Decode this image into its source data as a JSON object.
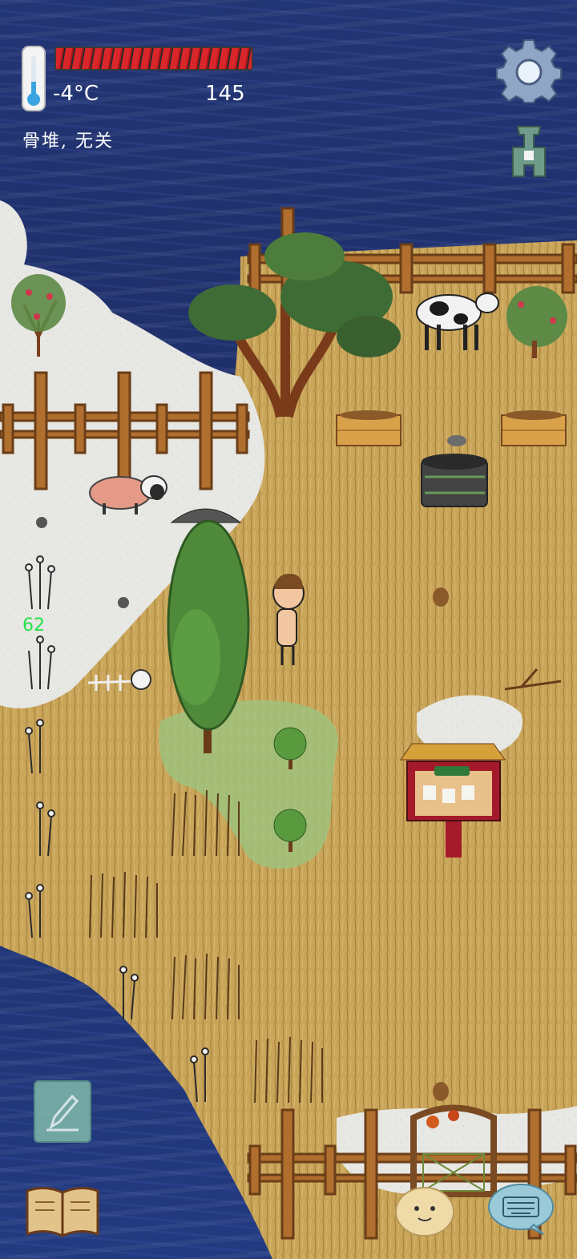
{
  "hud": {
    "temperature": "-4°C",
    "count": "145",
    "status": "骨堆, 无关",
    "damage_number": "62",
    "health_fraction": 1.0
  },
  "icons": {
    "thermometer": "thermometer-icon",
    "settings": "gear-icon",
    "coin": "spade-coin-icon",
    "note": "pencil-icon",
    "book": "open-book-icon",
    "keyboard": "keyboard-chat-icon",
    "emote": "potato-face-emote-icon"
  },
  "colors": {
    "health_red": "#d9262a",
    "water_blue": "#223574",
    "grass": "#c9a55a",
    "snow": "#e9e9e6",
    "damage_green": "#24e24a"
  }
}
